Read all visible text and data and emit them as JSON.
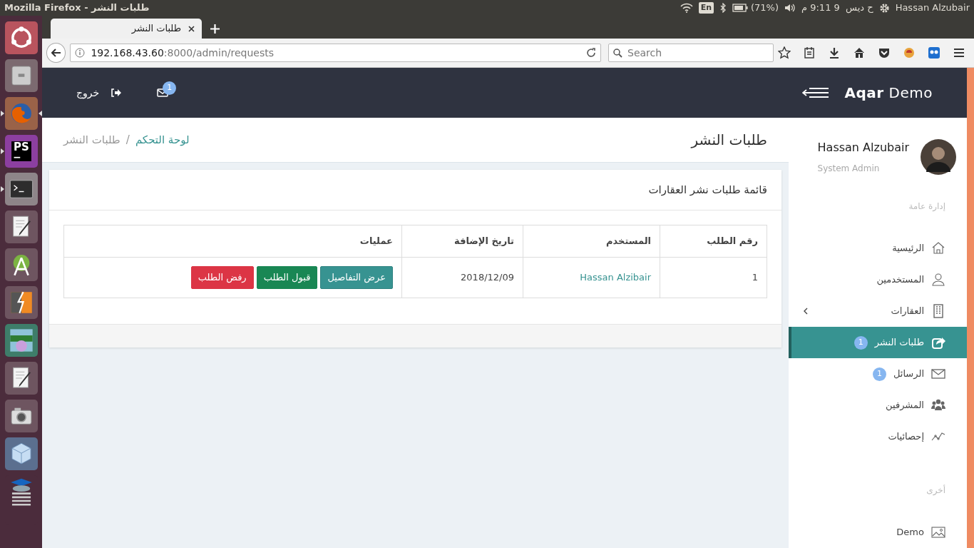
{
  "system_bar": {
    "window_title": "Mozilla Firefox - طلبات النشر",
    "keyboard": "En",
    "battery": "(71%)",
    "clock": "ح ديس  9 9:11 م",
    "user": "Hassan Alzubair"
  },
  "launcher": [
    {
      "kind": "ubuntu",
      "running": false,
      "focused": false
    },
    {
      "kind": "files",
      "running": false,
      "focused": false
    },
    {
      "kind": "firefox",
      "running": true,
      "focused": true
    },
    {
      "kind": "ide",
      "label": "PS",
      "running": true,
      "focused": false
    },
    {
      "kind": "terminal",
      "running": true,
      "focused": false
    },
    {
      "kind": "editor",
      "running": false,
      "focused": false
    },
    {
      "kind": "android",
      "running": false,
      "focused": false
    },
    {
      "kind": "bolt",
      "running": false,
      "focused": false
    },
    {
      "kind": "artwork",
      "running": false,
      "focused": false
    },
    {
      "kind": "editor",
      "running": false,
      "focused": false
    },
    {
      "kind": "camera",
      "running": false,
      "focused": false
    },
    {
      "kind": "cube",
      "running": false,
      "focused": false
    },
    {
      "kind": "stack",
      "running": false,
      "focused": false
    }
  ],
  "browser": {
    "tab": {
      "title": "طلبات النشر"
    },
    "url": {
      "host": "192.168.43.60",
      "rest": ":8000/admin/requests"
    },
    "search": {
      "placeholder": "Search"
    }
  },
  "header": {
    "brand_bold": "Aqar",
    "brand_rest": "Demo",
    "mail_badge": "1",
    "logout": "خروج"
  },
  "page": {
    "title": "طلبات النشر",
    "breadcrumb": [
      {
        "label": "لوحة التحكم",
        "kind": "link"
      },
      {
        "label": "طلبات النشر",
        "kind": "current"
      }
    ],
    "separator": "/"
  },
  "card": {
    "title": "قائمة طلبات نشر العقارات",
    "table": {
      "columns": [
        "رقم الطلب",
        "المستخدم",
        "تاريخ الإضافة",
        "عمليات"
      ],
      "rows": [
        {
          "id": "1",
          "user": "Hassan Alzibair",
          "date": "2018/12/09",
          "actions": [
            {
              "label": "عرض التفاصيل",
              "kind": "info"
            },
            {
              "label": "قبول الطلب",
              "kind": "success"
            },
            {
              "label": "رفض الطلب",
              "kind": "danger"
            }
          ]
        }
      ]
    }
  },
  "sidebar": {
    "user": {
      "name": "Hassan Alzubair",
      "role": "System Admin"
    },
    "sections": [
      {
        "title": "إدارة عامة",
        "items": [
          {
            "label": "الرئيسية",
            "kind": "home",
            "selected": false
          },
          {
            "label": "المستخدمين",
            "kind": "user",
            "selected": false
          },
          {
            "label": "العقارات",
            "kind": "building",
            "selected": false,
            "expandable": true
          },
          {
            "label": "طلبات النشر",
            "kind": "share",
            "selected": true,
            "badge": "1"
          },
          {
            "label": "الرسائل",
            "kind": "mail",
            "selected": false,
            "badge": "1"
          },
          {
            "label": "المشرفين",
            "kind": "users",
            "selected": false
          },
          {
            "label": "إحصائيات",
            "kind": "chart",
            "selected": false
          }
        ]
      },
      {
        "title": "أخرى",
        "items": [
          {
            "label": "Demo",
            "kind": "image",
            "selected": false
          }
        ]
      }
    ]
  }
}
